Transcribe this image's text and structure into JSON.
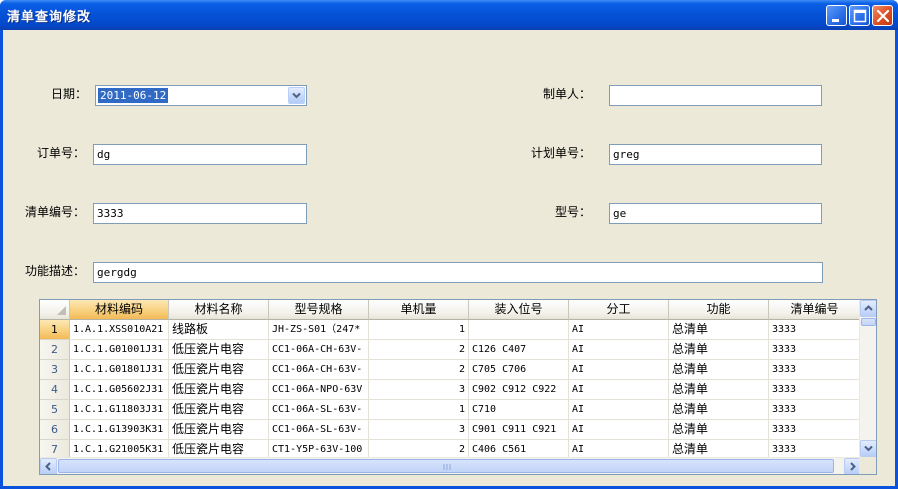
{
  "window": {
    "title": "清单查询修改"
  },
  "form": {
    "date_label": "日期：",
    "date_value": "2011-06-12",
    "creator_label": "制单人：",
    "creator_value": "",
    "order_no_label": "订单号：",
    "order_no_value": "dg",
    "plan_no_label": "计划单号：",
    "plan_no_value": "greg",
    "list_no_label": "清单编号：",
    "list_no_value": "3333",
    "model_label": "型号：",
    "model_value": "ge",
    "func_desc_label": "功能描述：",
    "func_desc_value": "gergdg"
  },
  "grid": {
    "columns": [
      "材料编码",
      "材料名称",
      "型号规格",
      "单机量",
      "装入位号",
      "分工",
      "功能",
      "清单编号"
    ],
    "rows": [
      {
        "n": "1",
        "code": "1.A.1.XSS010A21",
        "name": "线路板",
        "spec": "JH-ZS-S01（247*",
        "qty": "1",
        "pos": "",
        "div": "AI",
        "func": "总清单",
        "list": "3333"
      },
      {
        "n": "2",
        "code": "1.C.1.G01001J31",
        "name": "低压瓷片电容",
        "spec": "CC1-06A-CH-63V-",
        "qty": "2",
        "pos": "C126 C407",
        "div": "AI",
        "func": "总清单",
        "list": "3333"
      },
      {
        "n": "3",
        "code": "1.C.1.G01801J31",
        "name": "低压瓷片电容",
        "spec": "CC1-06A-CH-63V-",
        "qty": "2",
        "pos": "C705 C706",
        "div": "AI",
        "func": "总清单",
        "list": "3333"
      },
      {
        "n": "4",
        "code": "1.C.1.G05602J31",
        "name": "低压瓷片电容",
        "spec": "CC1-06A-NPO-63V",
        "qty": "3",
        "pos": "C902 C912 C922",
        "div": "AI",
        "func": "总清单",
        "list": "3333"
      },
      {
        "n": "5",
        "code": "1.C.1.G11803J31",
        "name": "低压瓷片电容",
        "spec": "CC1-06A-SL-63V-",
        "qty": "1",
        "pos": "C710",
        "div": "AI",
        "func": "总清单",
        "list": "3333"
      },
      {
        "n": "6",
        "code": "1.C.1.G13903K31",
        "name": "低压瓷片电容",
        "spec": "CC1-06A-SL-63V-",
        "qty": "3",
        "pos": "C901 C911 C921",
        "div": "AI",
        "func": "总清单",
        "list": "3333"
      },
      {
        "n": "7",
        "code": "1.C.1.G21005K31",
        "name": "低压瓷片电容",
        "spec": "CT1-Y5P-63V-100",
        "qty": "2",
        "pos": "C406 C561",
        "div": "AI",
        "func": "总清单",
        "list": "3333"
      }
    ]
  },
  "icons": {
    "minimize": "minimize-icon",
    "maximize": "maximize-icon",
    "close": "close-icon",
    "dropdown": "chevron-down-icon",
    "scroll_up": "arrow-up-icon",
    "scroll_down": "arrow-down-icon",
    "scroll_left": "arrow-left-icon",
    "scroll_right": "arrow-right-icon"
  },
  "colors": {
    "titlebar": "#0551d6",
    "client_bg": "#ece9d8",
    "selection": "#316ac5",
    "selected_header": "#f8cf7c"
  }
}
